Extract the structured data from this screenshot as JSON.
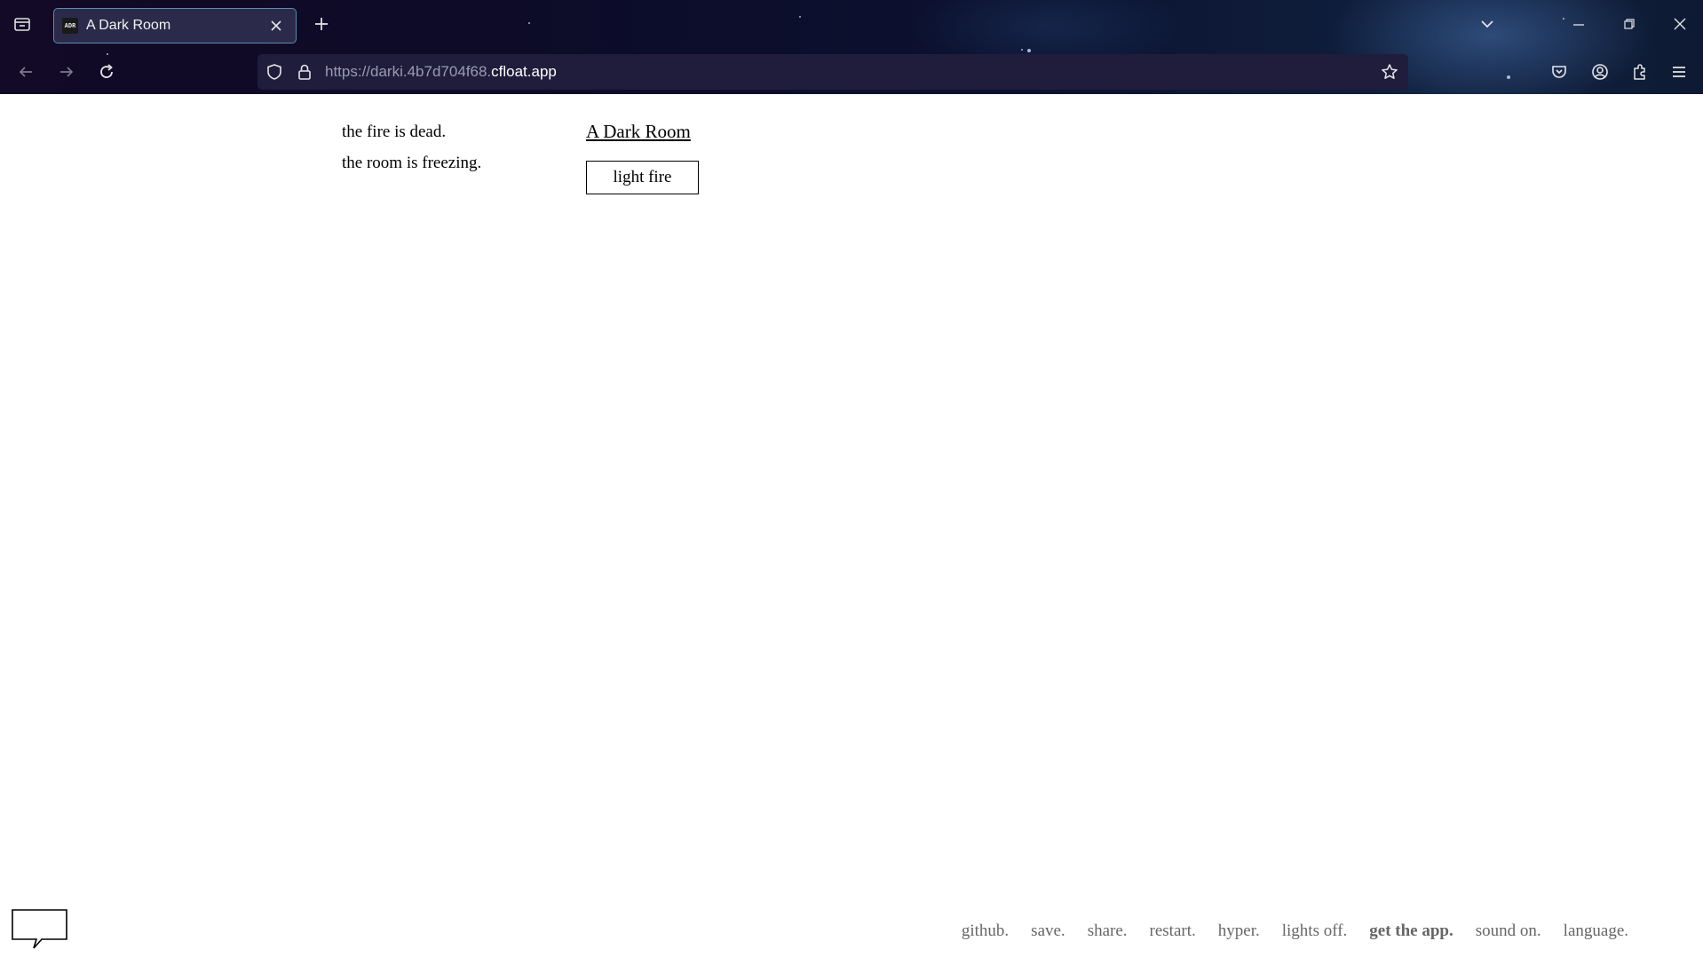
{
  "browser": {
    "tab_title": "A Dark Room",
    "tab_favicon_text": "ADR",
    "url_prefix": "https://darki.4b7d704f68.",
    "url_host": "cfloat.app",
    "accent_color": "#5a8bb0"
  },
  "game": {
    "notifications": [
      "the fire is dead.",
      "the room is freezing."
    ],
    "location": "A Dark Room",
    "action_button": "light fire"
  },
  "footer": {
    "links": [
      "github.",
      "save.",
      "share.",
      "restart.",
      "hyper.",
      "lights off.",
      "get the app.",
      "sound on.",
      "language."
    ]
  },
  "icons": {
    "chat": "speech-bubble-icon"
  }
}
